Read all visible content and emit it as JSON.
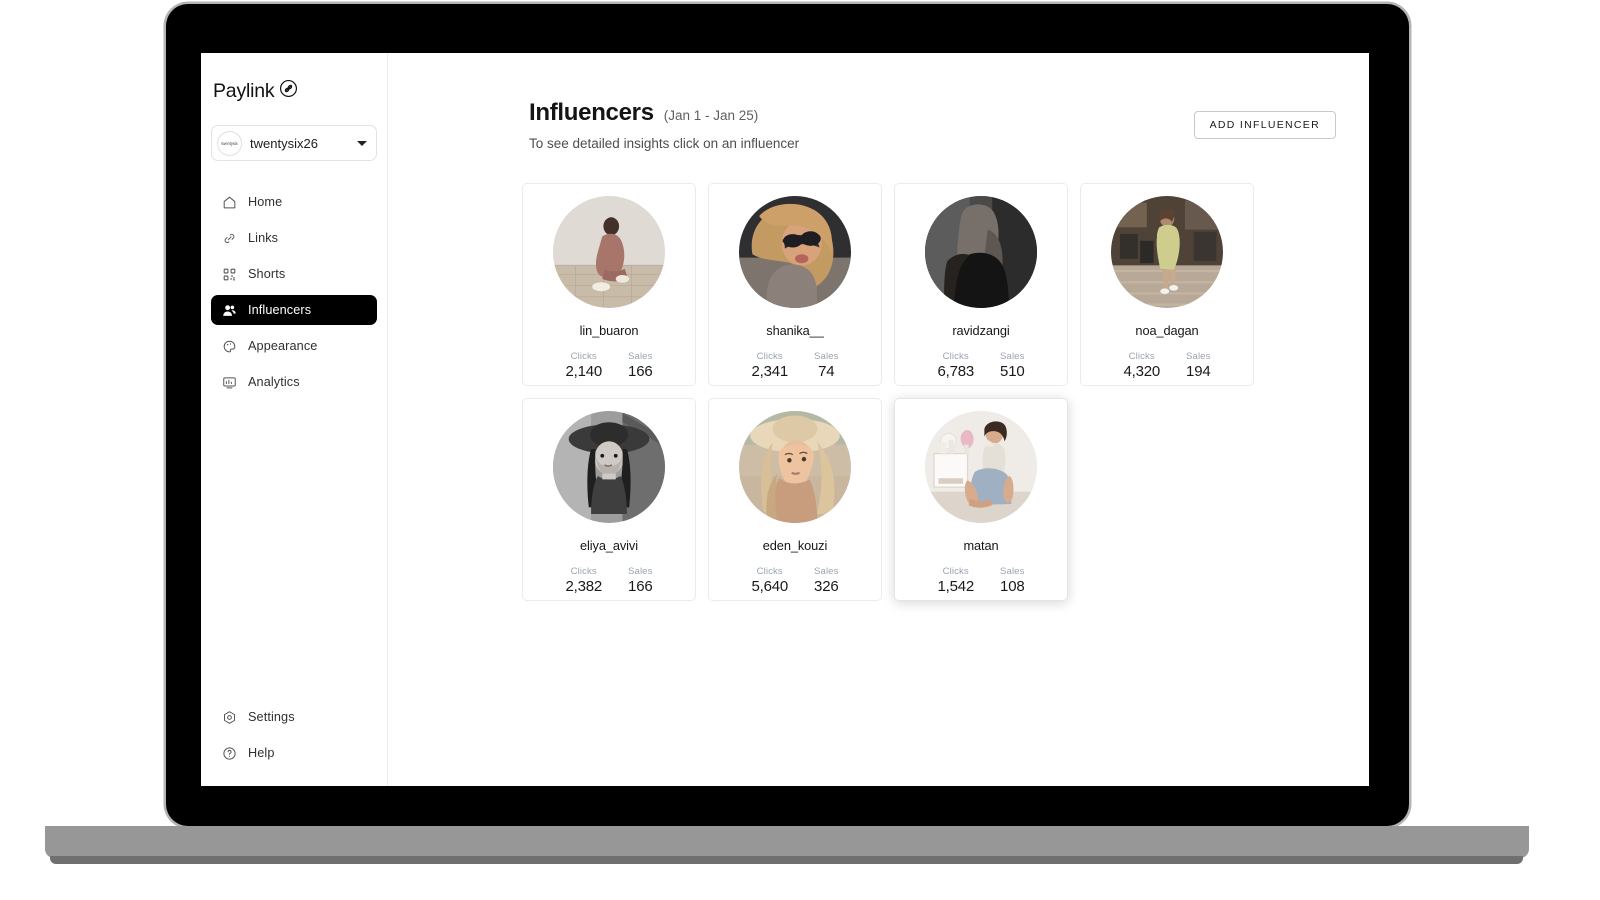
{
  "brand": {
    "name": "Paylink",
    "mark_icon": "link-circle-icon"
  },
  "workspace": {
    "name": "twentysix26",
    "avatar_text": "twentysix",
    "caret_icon": "chevron-down-icon"
  },
  "sidebar": {
    "items": [
      {
        "label": "Home",
        "icon": "home-icon",
        "active": false
      },
      {
        "label": "Links",
        "icon": "link-icon",
        "active": false
      },
      {
        "label": "Shorts",
        "icon": "qr-grid-icon",
        "active": false
      },
      {
        "label": "Influencers",
        "icon": "people-icon",
        "active": true
      },
      {
        "label": "Appearance",
        "icon": "palette-icon",
        "active": false
      },
      {
        "label": "Analytics",
        "icon": "monitor-icon",
        "active": false
      }
    ],
    "bottom_items": [
      {
        "label": "Settings",
        "icon": "gear-icon",
        "active": false
      },
      {
        "label": "Help",
        "icon": "question-mark-icon",
        "active": false
      }
    ]
  },
  "header": {
    "title": "Influencers",
    "date_range": "(Jan 1 - Jan 25)",
    "subtitle": "To see detailed insights click on an influencer",
    "add_button_label": "ADD INFLUENCER"
  },
  "stat_labels": {
    "clicks": "Clicks",
    "sales": "Sales"
  },
  "influencers": [
    {
      "name": "lin_buaron",
      "clicks": "2,140",
      "sales": "166",
      "selected": false,
      "clicks_label": "Clicks",
      "sales_label": "Sales",
      "photo": {
        "style": "woman-seated-mauve-outfit",
        "c1": "#d9d3cd",
        "c2": "#a8756a",
        "c3": "#cfc3b4"
      }
    },
    {
      "name": "shanika__",
      "clicks": "2,341",
      "sales": "74",
      "selected": false,
      "clicks_label": "Clicks",
      "sales_label": "Sales",
      "photo": {
        "style": "woman-curly-hair-sunglasses",
        "c1": "#3b3a3c",
        "c2": "#c39a64",
        "c3": "#7e756e"
      }
    },
    {
      "name": "ravidzangi",
      "clicks": "6,783",
      "sales": "510",
      "selected": false,
      "clicks_label": "Clicks",
      "sales_label": "Sales",
      "photo": {
        "style": "bw-long-hair-portrait",
        "c1": "#141414",
        "c2": "#6e6e6e",
        "c3": "#2a2a2a"
      }
    },
    {
      "name": "noa_dagan",
      "clicks": "4,320",
      "sales": "194",
      "selected": false,
      "clicks_label": "Clicks",
      "sales_label": "Sales",
      "photo": {
        "style": "woman-green-dress-street",
        "c1": "#6a5f53",
        "c2": "#cfcd8e",
        "c3": "#b9ac9b"
      }
    },
    {
      "name": "eliya_avivi",
      "clicks": "2,382",
      "sales": "166",
      "selected": false,
      "clicks_label": "Clicks",
      "sales_label": "Sales",
      "photo": {
        "style": "bw-woman-wide-hat",
        "c1": "#2f2f2f",
        "c2": "#9a9a9a",
        "c3": "#d6d6d6"
      }
    },
    {
      "name": "eden_kouzi",
      "clicks": "5,640",
      "sales": "326",
      "selected": false,
      "clicks_label": "Clicks",
      "sales_label": "Sales",
      "photo": {
        "style": "blonde-woman-straw-hat",
        "c1": "#d9c29a",
        "c2": "#e8c9a6",
        "c3": "#a98f6f"
      }
    },
    {
      "name": "matan",
      "clicks": "1,542",
      "sales": "108",
      "selected": true,
      "clicks_label": "Clicks",
      "sales_label": "Sales",
      "photo": {
        "style": "woman-seated-bedroom-white",
        "c1": "#ece8e4",
        "c2": "#9fb0c3",
        "c3": "#cdb9a8"
      }
    }
  ],
  "colors": {
    "accent": "#000000",
    "card_border": "#e8ecef",
    "stat_label": "#9aa3b2",
    "text_primary": "#171717",
    "text_muted": "#4e4e4e"
  }
}
